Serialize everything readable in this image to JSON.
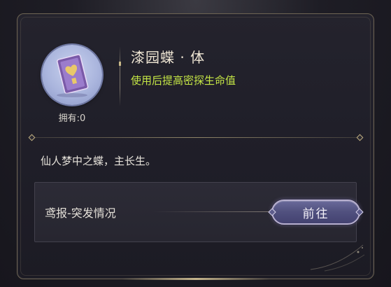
{
  "item": {
    "name": "漆园蝶 · 体",
    "description": "使用后提高密探生命值",
    "owned_label": "拥有:0",
    "icon": "card-item-icon",
    "flavor_text": "仙人梦中之蝶，主长生。"
  },
  "source": {
    "label": "鸢报-突发情况",
    "go_button_label": "前往"
  },
  "colors": {
    "desc_accent": "#c4e545",
    "button_fill": "#50507e",
    "frame_border": "#6b6252"
  }
}
